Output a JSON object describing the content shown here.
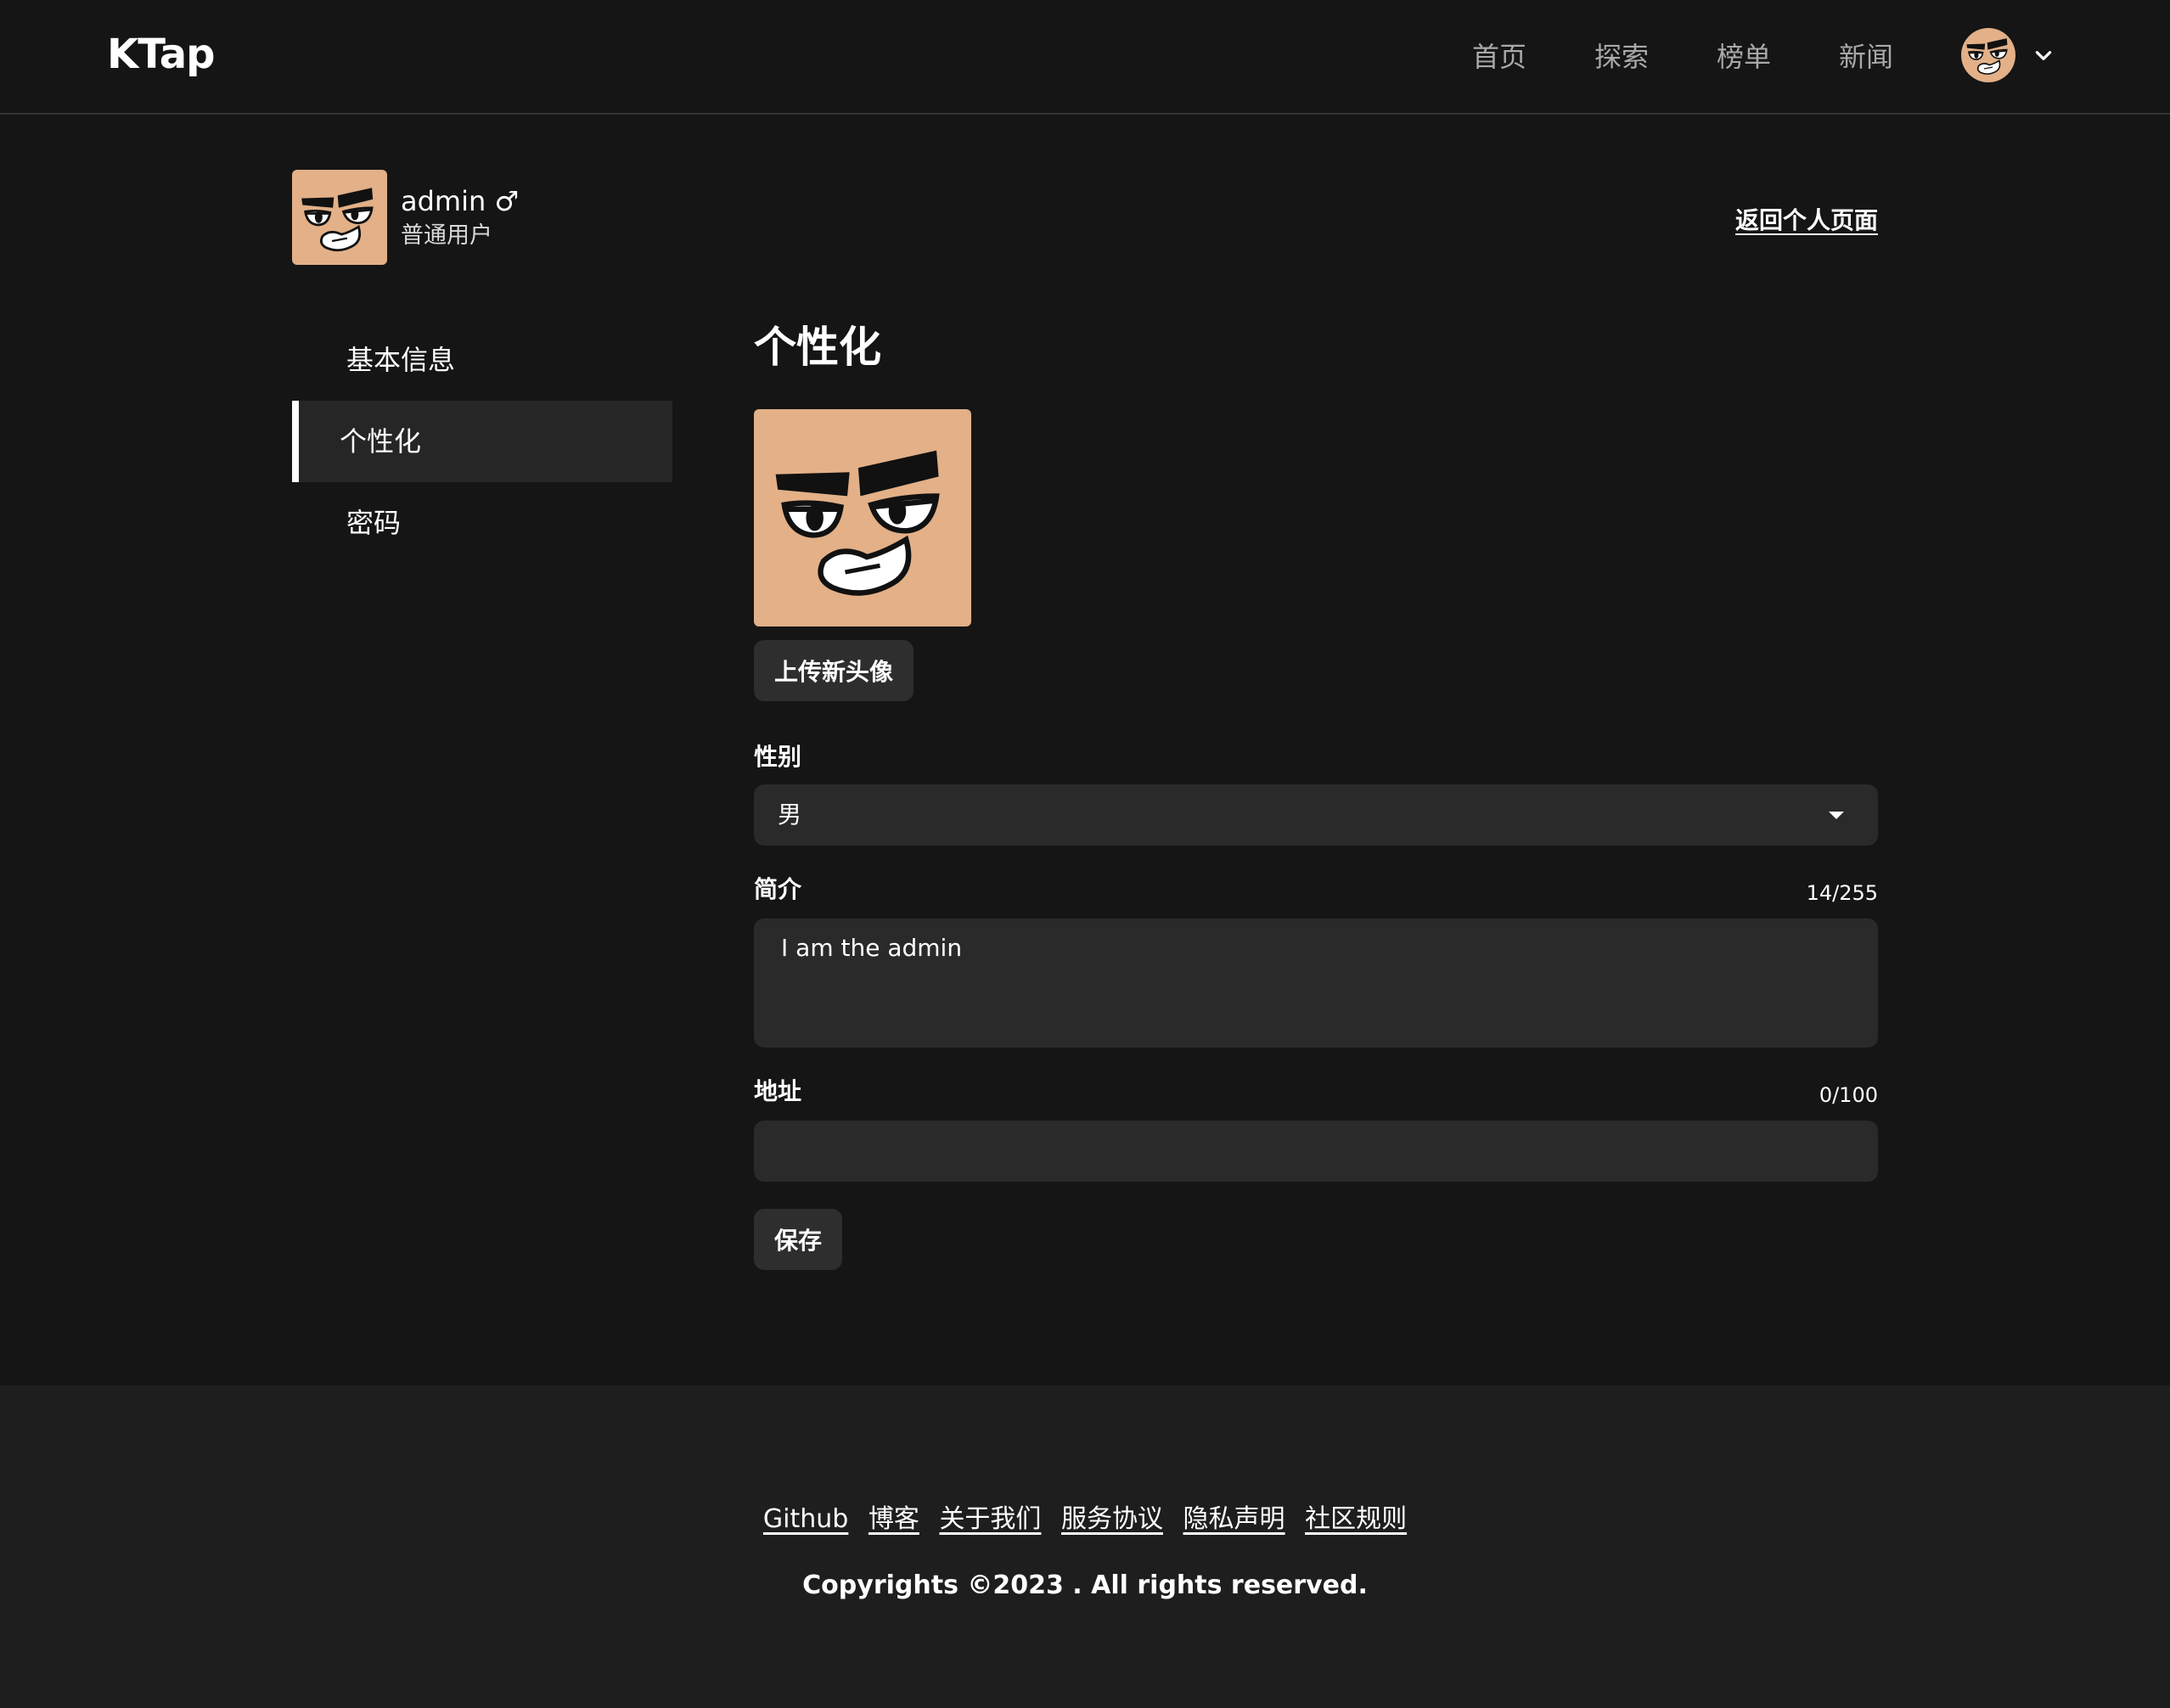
{
  "header": {
    "logo": "KTap",
    "nav": [
      "首页",
      "探索",
      "榜单",
      "新闻"
    ]
  },
  "profile": {
    "username": "admin ♂",
    "role": "普通用户",
    "back_link": "返回个人页面"
  },
  "sidebar": {
    "items": [
      {
        "label": "基本信息",
        "active": false
      },
      {
        "label": "个性化",
        "active": true
      },
      {
        "label": "密码",
        "active": false
      }
    ]
  },
  "personalize": {
    "title": "个性化",
    "upload_label": "上传新头像",
    "gender_label": "性别",
    "gender_value": "男",
    "bio_label": "简介",
    "bio_counter": "14/255",
    "bio_value": "I am the admin",
    "address_label": "地址",
    "address_counter": "0/100",
    "address_value": "",
    "save_label": "保存"
  },
  "footer": {
    "links": [
      "Github",
      "博客",
      "关于我们",
      "服务协议",
      "隐私声明",
      "社区规则"
    ],
    "copyright": "Copyrights ©2023 . All rights reserved."
  },
  "colors": {
    "background": "#151515",
    "panel": "#2a2a2a",
    "footer": "#1e1e1e",
    "avatar_skin": "#e3b087"
  },
  "icons": [
    "avatar-face-icon",
    "chevron-down-icon",
    "select-caret-icon"
  ]
}
